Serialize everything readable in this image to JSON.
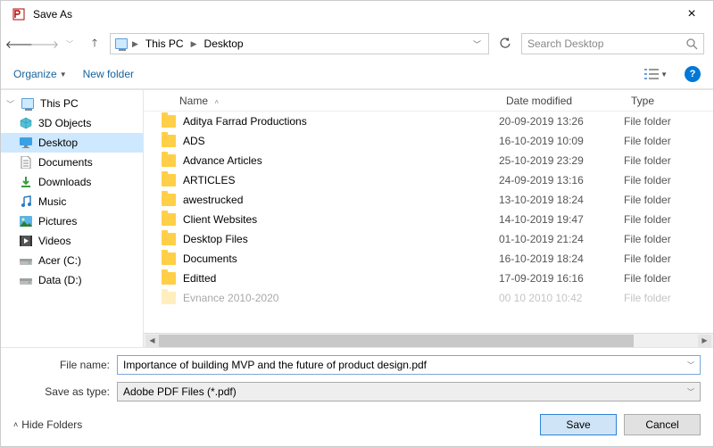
{
  "window": {
    "title": "Save As"
  },
  "breadcrumb": {
    "root": "This PC",
    "folder": "Desktop"
  },
  "search": {
    "placeholder": "Search Desktop"
  },
  "toolbar": {
    "organize": "Organize",
    "newfolder": "New folder"
  },
  "sidebar": {
    "items": [
      {
        "label": "This PC",
        "icon": "pc",
        "root": true
      },
      {
        "label": "3D Objects",
        "icon": "3d"
      },
      {
        "label": "Desktop",
        "icon": "desktop",
        "selected": true
      },
      {
        "label": "Documents",
        "icon": "doc"
      },
      {
        "label": "Downloads",
        "icon": "dl"
      },
      {
        "label": "Music",
        "icon": "music"
      },
      {
        "label": "Pictures",
        "icon": "pic"
      },
      {
        "label": "Videos",
        "icon": "vid"
      },
      {
        "label": "Acer (C:)",
        "icon": "drive"
      },
      {
        "label": "Data (D:)",
        "icon": "drive"
      }
    ]
  },
  "columns": {
    "name": "Name",
    "date": "Date modified",
    "type": "Type"
  },
  "files": [
    {
      "name": "Aditya Farrad Productions",
      "date": "20-09-2019 13:26",
      "type": "File folder"
    },
    {
      "name": "ADS",
      "date": "16-10-2019 10:09",
      "type": "File folder"
    },
    {
      "name": "Advance Articles",
      "date": "25-10-2019 23:29",
      "type": "File folder"
    },
    {
      "name": "ARTICLES",
      "date": "24-09-2019 13:16",
      "type": "File folder"
    },
    {
      "name": "awestrucked",
      "date": "13-10-2019 18:24",
      "type": "File folder"
    },
    {
      "name": "Client Websites",
      "date": "14-10-2019 19:47",
      "type": "File folder"
    },
    {
      "name": "Desktop Files",
      "date": "01-10-2019 21:24",
      "type": "File folder"
    },
    {
      "name": "Documents",
      "date": "16-10-2019 18:24",
      "type": "File folder"
    },
    {
      "name": "Editted",
      "date": "17-09-2019 16:16",
      "type": "File folder"
    },
    {
      "name": "Evnance 2010-2020",
      "date": "00 10 2010 10:42",
      "type": "File folder",
      "faded": true
    }
  ],
  "filename": {
    "label": "File name:",
    "value": "Importance of building MVP and the future of product design.pdf"
  },
  "filetype": {
    "label": "Save as type:",
    "value": "Adobe PDF Files (*.pdf)"
  },
  "footer": {
    "hide": "Hide Folders",
    "save": "Save",
    "cancel": "Cancel"
  }
}
